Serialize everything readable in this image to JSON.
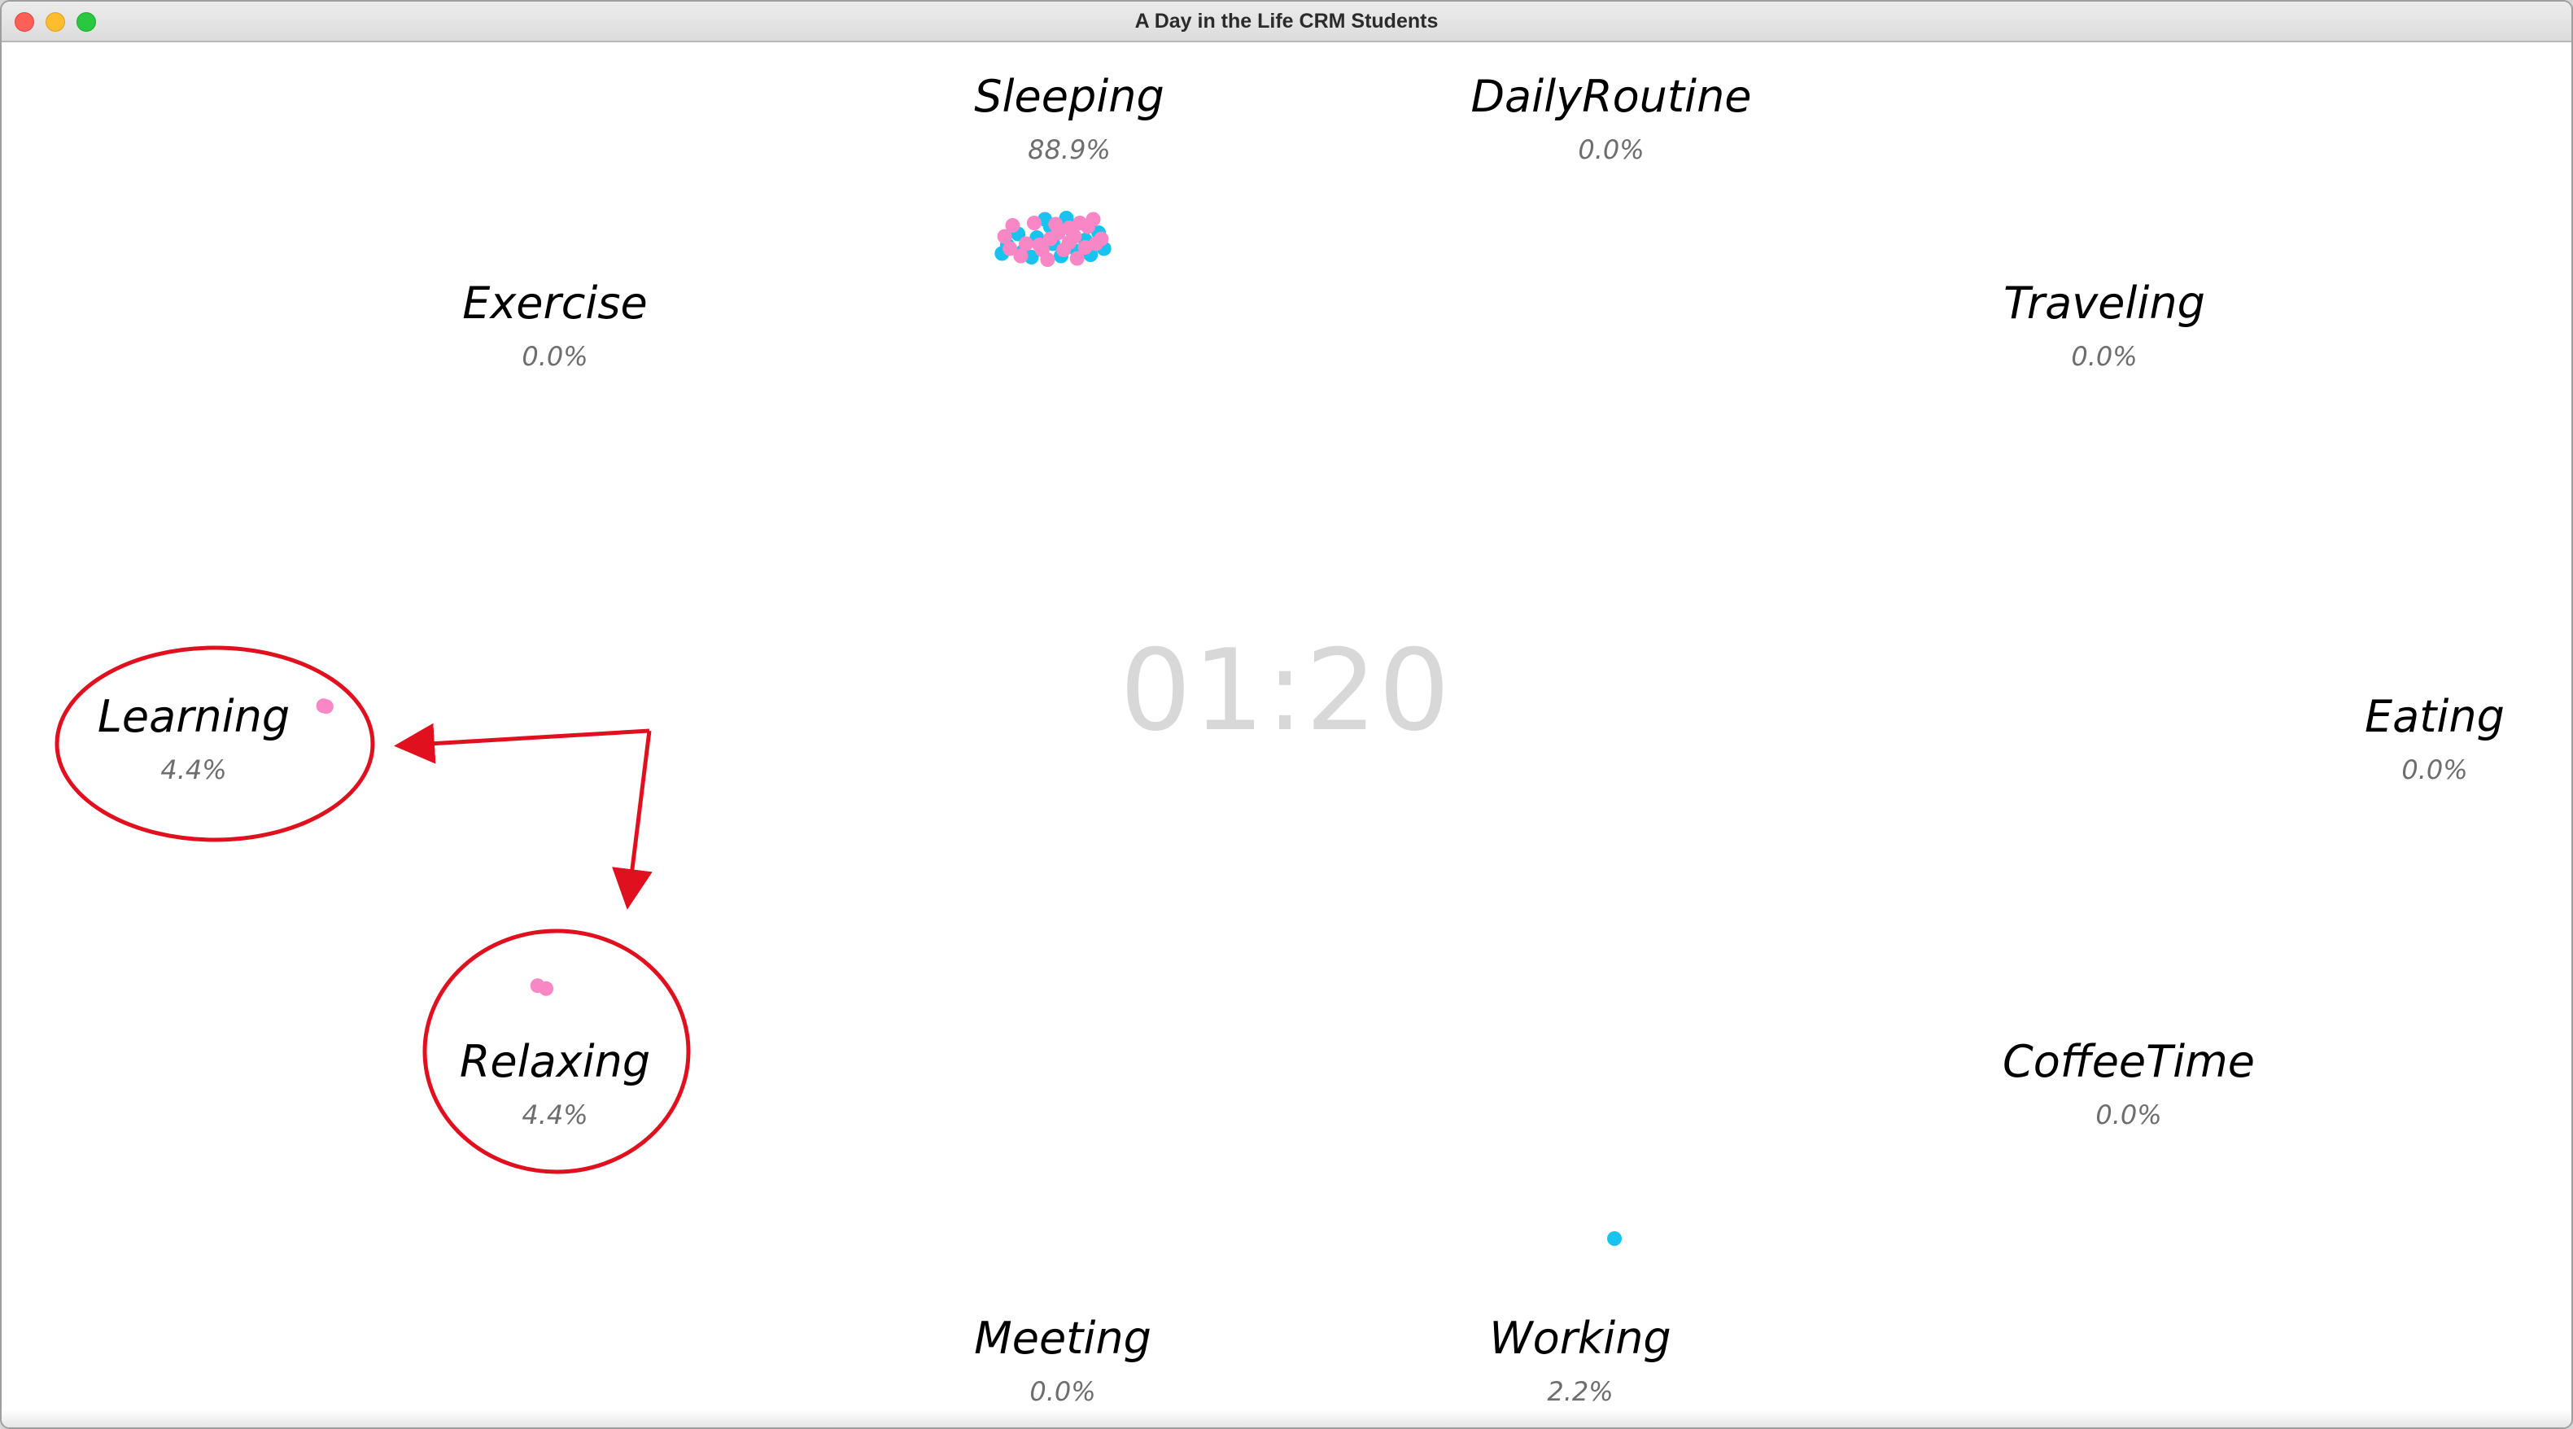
{
  "window": {
    "title": "A Day in the Life CRM Students"
  },
  "clock": {
    "time": "01:20"
  },
  "activities": [
    {
      "id": "sleeping",
      "name": "Sleeping",
      "percent": "88.9%"
    },
    {
      "id": "dailyroutine",
      "name": "DailyRoutine",
      "percent": "0.0%"
    },
    {
      "id": "exercise",
      "name": "Exercise",
      "percent": "0.0%"
    },
    {
      "id": "traveling",
      "name": "Traveling",
      "percent": "0.0%"
    },
    {
      "id": "learning",
      "name": "Learning",
      "percent": "4.4%"
    },
    {
      "id": "eating",
      "name": "Eating",
      "percent": "0.0%"
    },
    {
      "id": "relaxing",
      "name": "Relaxing",
      "percent": "4.4%"
    },
    {
      "id": "coffeetime",
      "name": "CoffeeTime",
      "percent": "0.0%"
    },
    {
      "id": "meeting",
      "name": "Meeting",
      "percent": "0.0%"
    },
    {
      "id": "working",
      "name": "Working",
      "percent": "2.2%"
    }
  ],
  "colors": {
    "pink_dot": "#f987c5",
    "blue_dot": "#19c3f0",
    "annotation": "#e0101e",
    "clock_text": "#d8d8d8",
    "percent_text": "#6e6e6e"
  },
  "dots": {
    "sleeping": {
      "pink": 23,
      "blue": 17
    },
    "learning": {
      "pink": 2,
      "blue": 0
    },
    "relaxing": {
      "pink": 2,
      "blue": 0
    },
    "working": {
      "pink": 0,
      "blue": 1
    }
  },
  "annotations": {
    "circled": [
      "learning",
      "relaxing"
    ],
    "arrow_targets": [
      "learning",
      "relaxing"
    ]
  },
  "window_controls": [
    "close-icon",
    "minimize-icon",
    "zoom-icon"
  ]
}
